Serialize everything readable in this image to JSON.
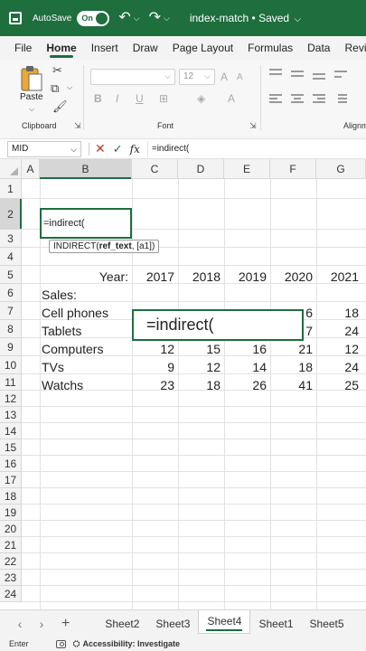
{
  "titlebar": {
    "autosave_label": "AutoSave",
    "toggle_state": "On",
    "doc_title": "index-match • Saved",
    "bg_color": "#1e6e3e"
  },
  "menu": {
    "tabs": [
      "File",
      "Home",
      "Insert",
      "Draw",
      "Page Layout",
      "Formulas",
      "Data",
      "Review"
    ],
    "active": "Home"
  },
  "ribbon": {
    "paste_label": "Paste",
    "font_size_value": "12",
    "groups": {
      "clipboard": "Clipboard",
      "font": "Font",
      "alignment": "Alignm"
    }
  },
  "formula_bar": {
    "name_box": "MID",
    "fx_label": "fx",
    "content": "=indirect("
  },
  "grid": {
    "columns": [
      "A",
      "B",
      "C",
      "D",
      "E",
      "F",
      "G"
    ],
    "rows": [
      "1",
      "2",
      "3",
      "4",
      "5",
      "6",
      "7",
      "8",
      "9",
      "10",
      "11",
      "12",
      "13",
      "14",
      "15",
      "16",
      "17",
      "18",
      "19",
      "20",
      "21",
      "22",
      "23",
      "24"
    ],
    "selected_column": "B",
    "selected_row": "2",
    "active_cell_text": "=indirect(",
    "tooltip": {
      "func": "INDIRECT(",
      "arg_bold": "ref_text",
      "rest": ", [a1])"
    },
    "zoom_overlay_text": "=indirect(",
    "year_label": "Year:",
    "years": [
      "2017",
      "2018",
      "2019",
      "2020",
      "2021"
    ],
    "sales_label": "Sales:",
    "products": [
      {
        "name": "Cell phones",
        "values": [
          "",
          "",
          "",
          "6",
          "18"
        ]
      },
      {
        "name": "Tablets",
        "values": [
          "",
          "",
          "",
          "7",
          "24"
        ]
      },
      {
        "name": "Computers",
        "values": [
          "12",
          "15",
          "16",
          "21",
          "12"
        ]
      },
      {
        "name": "TVs",
        "values": [
          "9",
          "12",
          "14",
          "18",
          "24"
        ]
      },
      {
        "name": "Watchs",
        "values": [
          "23",
          "18",
          "26",
          "41",
          "25"
        ]
      }
    ]
  },
  "sheets": {
    "tabs": [
      "Sheet2",
      "Sheet3",
      "Sheet4",
      "Sheet1",
      "Sheet5"
    ],
    "active": "Sheet4",
    "add_label": "+"
  },
  "status": {
    "mode": "Enter",
    "accessibility": "Accessibility: Investigate"
  }
}
